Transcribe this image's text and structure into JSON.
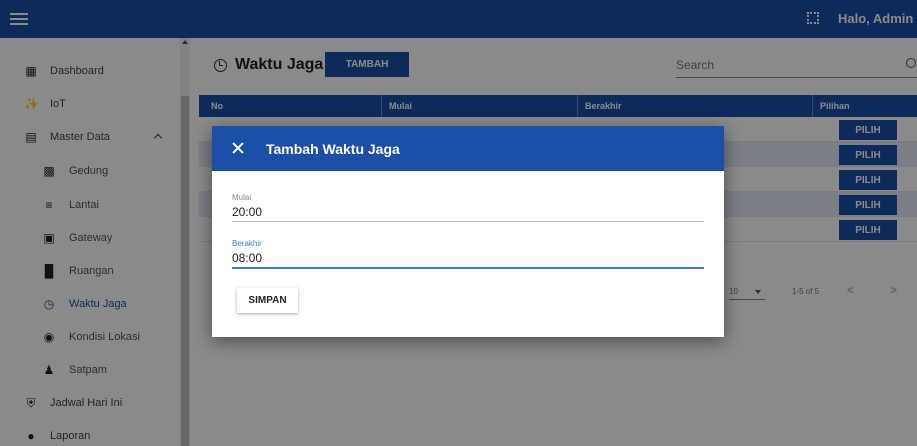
{
  "topbar": {
    "greeting": "Halo, Admin"
  },
  "sidebar": {
    "items": [
      {
        "label": "Dashboard"
      },
      {
        "label": "IoT"
      },
      {
        "label": "Master Data"
      },
      {
        "label": "Gedung"
      },
      {
        "label": "Lantai"
      },
      {
        "label": "Gateway"
      },
      {
        "label": "Ruangan"
      },
      {
        "label": "Waktu Jaga"
      },
      {
        "label": "Kondisi Lokasi"
      },
      {
        "label": "Satpam"
      },
      {
        "label": "Jadwal Hari Ini"
      },
      {
        "label": "Laporan"
      }
    ]
  },
  "main": {
    "title": "Waktu Jaga",
    "add_label": "TAMBAH",
    "search_placeholder": "Search",
    "columns": [
      "No",
      "Mulai",
      "Berakhir",
      "Pilihan"
    ],
    "row_action_label": "PILIH",
    "rows_per_page": "10",
    "range": "1-5 of 5",
    "prev": "<",
    "next": ">"
  },
  "dialog": {
    "title": "Tambah Waktu Jaga",
    "mulai_label": "Mulai",
    "mulai_value": "20:00",
    "berakhir_label": "Berakhir",
    "berakhir_value": "08:00",
    "save_label": "SIMPAN"
  },
  "colors": {
    "primary": "#1b4fa8",
    "focus": "#3a7be0",
    "row_alt": "#e4e9f5"
  }
}
